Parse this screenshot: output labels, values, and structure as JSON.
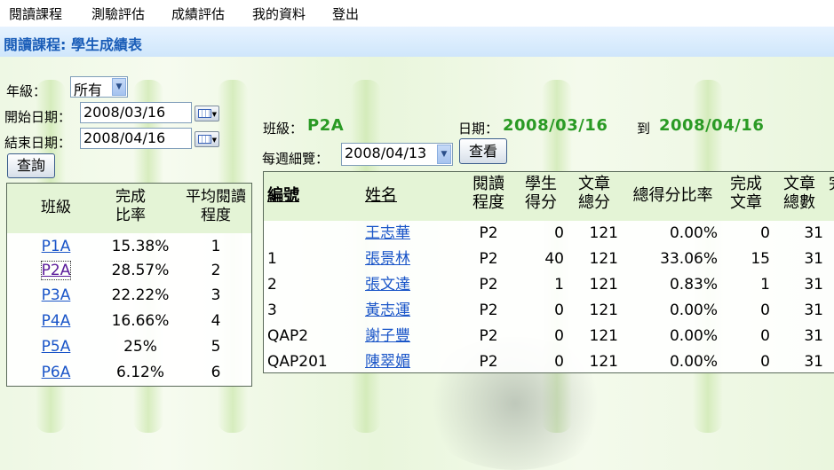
{
  "menu": [
    "閱讀課程",
    "測驗評估",
    "成績評估",
    "我的資料",
    "登出"
  ],
  "page_title": "閱讀課程: 學生成績表",
  "filters": {
    "grade_label": "年級：",
    "grade_value": "所有",
    "start_label": "開始日期：",
    "start_value": "2008/03/16",
    "end_label": "結束日期：",
    "end_value": "2008/04/16",
    "query_button": "查詢"
  },
  "info": {
    "class_label": "班級：",
    "class_value": "P2A",
    "date_label": "日期：",
    "date_from": "2008/03/16",
    "date_to_label": "到",
    "date_to": "2008/04/16",
    "weekly_label": "每週細覽：",
    "weekly_value": "2008/04/13",
    "view_button": "查看"
  },
  "class_table": {
    "headers": [
      "班級",
      "完成比率",
      "平均閱讀程度"
    ],
    "rows": [
      {
        "class": "P1A",
        "rate": "15.38%",
        "level": "1"
      },
      {
        "class": "P2A",
        "rate": "28.57%",
        "level": "2"
      },
      {
        "class": "P3A",
        "rate": "22.22%",
        "level": "3"
      },
      {
        "class": "P4A",
        "rate": "16.66%",
        "level": "4"
      },
      {
        "class": "P5A",
        "rate": "25%",
        "level": "5"
      },
      {
        "class": "P6A",
        "rate": "6.12%",
        "level": "6"
      }
    ]
  },
  "student_table": {
    "headers": {
      "id": "編號",
      "name": "姓名",
      "level": "閱讀程度",
      "score": "學生得分",
      "total": "文章總分",
      "ratio": "總得分比率",
      "done": "完成文章",
      "count": "文章總數",
      "extra": "完"
    },
    "rows": [
      {
        "id": "",
        "name": "王志華",
        "level": "P2",
        "score": "0",
        "total": "121",
        "ratio": "0.00%",
        "done": "0",
        "count": "31"
      },
      {
        "id": "1",
        "name": "張景林",
        "level": "P2",
        "score": "40",
        "total": "121",
        "ratio": "33.06%",
        "done": "15",
        "count": "31"
      },
      {
        "id": "2",
        "name": "張文達",
        "level": "P2",
        "score": "1",
        "total": "121",
        "ratio": "0.83%",
        "done": "1",
        "count": "31"
      },
      {
        "id": "3",
        "name": "黃志運",
        "level": "P2",
        "score": "0",
        "total": "121",
        "ratio": "0.00%",
        "done": "0",
        "count": "31"
      },
      {
        "id": "QAP2",
        "name": "謝子豐",
        "level": "P2",
        "score": "0",
        "total": "121",
        "ratio": "0.00%",
        "done": "0",
        "count": "31"
      },
      {
        "id": "QAP201",
        "name": "陳翠媚",
        "level": "P2",
        "score": "0",
        "total": "121",
        "ratio": "0.00%",
        "done": "0",
        "count": "31"
      }
    ]
  }
}
